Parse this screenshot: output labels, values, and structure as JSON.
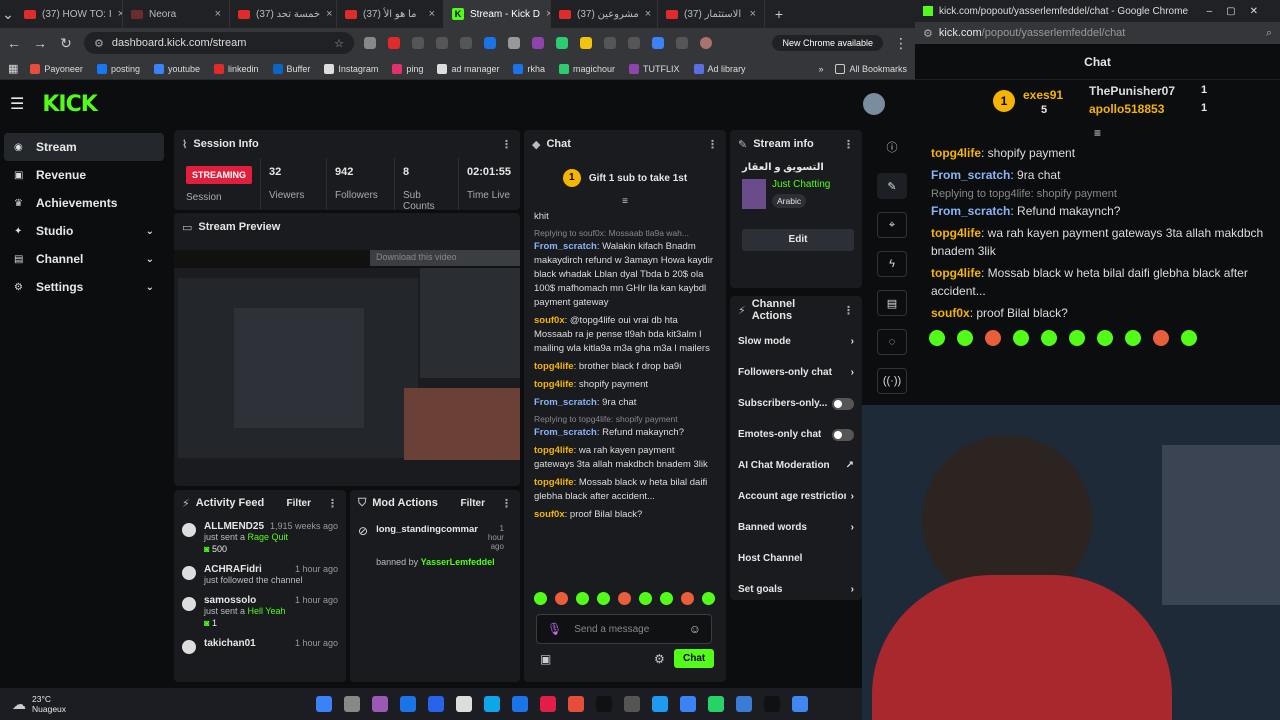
{
  "tabs": [
    {
      "label": "(37) HOW TO: I",
      "icon": "youtube"
    },
    {
      "label": "Neora",
      "icon": "web"
    },
    {
      "label": "(37) خمسة تحد",
      "icon": "youtube"
    },
    {
      "label": "(37) ما هو الأ",
      "icon": "youtube"
    },
    {
      "label": "Stream - Kick D",
      "icon": "kick",
      "active": true
    },
    {
      "label": "(37) مشروعين",
      "icon": "youtube"
    },
    {
      "label": "(37) الاستثمار",
      "icon": "youtube"
    }
  ],
  "address": "dashboard.kick.com/stream",
  "new_chrome": "New Chrome available",
  "bookmarks": [
    "Payoneer",
    "posting",
    "youtube",
    "linkedin",
    "Buffer",
    "Instagram",
    "ping",
    "ad manager",
    "rkha",
    "magichour",
    "TUTFLIX",
    "Ad library"
  ],
  "all_bookmarks": "All Bookmarks",
  "logo": "KICK",
  "sidebar": [
    "Stream",
    "Revenue",
    "Achievements",
    "Studio",
    "Channel",
    "Settings"
  ],
  "session": {
    "title": "Session Info",
    "badge": "STREAMING",
    "badge_sub": "Session",
    "stats": [
      {
        "n": "32",
        "l": "Viewers"
      },
      {
        "n": "942",
        "l": "Followers"
      },
      {
        "n": "8",
        "l": "Sub Counts"
      },
      {
        "n": "02:01:55",
        "l": "Time Live"
      }
    ]
  },
  "preview": {
    "title": "Stream Preview",
    "download": "Download this video"
  },
  "activity": {
    "title": "Activity Feed",
    "filter": "Filter",
    "items": [
      {
        "name": "ALLMEND25",
        "time": "1,915 weeks ago",
        "text": "just sent a ",
        "hl": "Rage Quit",
        "amount": "500"
      },
      {
        "name": "ACHRAFidri",
        "time": "1 hour ago",
        "text": "just followed the channel",
        "hl": "",
        "amount": ""
      },
      {
        "name": "samossolo",
        "time": "1 hour ago",
        "text": "just sent a ",
        "hl": "Hell Yeah",
        "amount": "1"
      },
      {
        "name": "takichan01",
        "time": "1 hour ago",
        "text": "",
        "hl": "",
        "amount": ""
      }
    ]
  },
  "mod": {
    "title": "Mod Actions",
    "filter": "Filter",
    "user": "long_standingcommar",
    "time": "1 hour ago",
    "banned_by": "banned by ",
    "by": "YasserLemfeddel"
  },
  "chat": {
    "title": "Chat",
    "gift": "Gift 1 sub to take 1st",
    "partial": "khit",
    "messages": [
      {
        "reply": "Replying to souf0x: Mossaab tla9a wah...",
        "user": "From_scratch",
        "color": "#8ab4f8",
        "text": "Walakin kifach Bnadm makaydirch refund w 3amayn Howa kaydir black whadak Lblan dyal Tbda b 20$ ola 100$ mafhomach mn GHIr lla kan kaybdl payment gateway"
      },
      {
        "reply": "",
        "user": "souf0x",
        "color": "#f4b400",
        "text": "@topg4life oui vrai db hta Mossaab ra je pense tl9ah bda kit3alm l mailing wla kitla9a m3a gha m3a l mailers"
      },
      {
        "reply": "",
        "user": "topg4life",
        "color": "#f4b400",
        "text": "brother black f drop ba9i"
      },
      {
        "reply": "",
        "user": "topg4life",
        "color": "#f4b400",
        "text": "shopify payment"
      },
      {
        "reply": "",
        "user": "From_scratch",
        "color": "#8ab4f8",
        "text": "9ra chat"
      },
      {
        "reply": "Replying to topg4life: shopify payment",
        "user": "From_scratch",
        "color": "#8ab4f8",
        "text": "Refund makaynch?"
      },
      {
        "reply": "",
        "user": "topg4life",
        "color": "#f4b400",
        "text": "wa rah kayen payment gateways 3ta allah makdbch bnadem 3lik"
      },
      {
        "reply": "",
        "user": "topg4life",
        "color": "#f4b400",
        "text": "Mossab black w heta bilal daifi glebha black after accident..."
      },
      {
        "reply": "",
        "user": "souf0x",
        "color": "#f4b400",
        "text": "proof Bilal black?"
      }
    ],
    "placeholder": "Send a message",
    "send": "Chat"
  },
  "stream_info": {
    "title": "Stream info",
    "stream_title": "التسويق و العقار",
    "category": "Just Chatting",
    "language": "Arabic",
    "edit": "Edit"
  },
  "channel_actions": {
    "title": "Channel Actions",
    "items": [
      {
        "label": "Slow mode",
        "type": "chevron"
      },
      {
        "label": "Followers-only chat",
        "type": "chevron"
      },
      {
        "label": "Subscribers-only...",
        "type": "toggle"
      },
      {
        "label": "Emotes-only chat",
        "type": "toggle"
      },
      {
        "label": "AI Chat Moderation",
        "type": "external"
      },
      {
        "label": "Account age restriction",
        "type": "chevron"
      },
      {
        "label": "Banned words",
        "type": "chevron"
      },
      {
        "label": "Host Channel",
        "type": "none"
      },
      {
        "label": "Set goals",
        "type": "chevron"
      }
    ]
  },
  "popout": {
    "window_title": "kick.com/popout/yasserlemfeddel/chat - Google Chrome",
    "url_host": "kick.com",
    "url_path": "/popout/yasserlemfeddel/chat",
    "header": "Chat",
    "leaders": [
      {
        "name": "exes91",
        "count": "5",
        "rank": "1"
      },
      {
        "name": "ThePunisher07",
        "count": "1"
      },
      {
        "name": "apollo518853",
        "count": "1"
      }
    ],
    "messages": [
      {
        "reply": "",
        "user": "topg4life",
        "color": "#f4b400",
        "text": "shopify payment"
      },
      {
        "reply": "",
        "user": "From_scratch",
        "color": "#8ab4f8",
        "text": "9ra chat"
      },
      {
        "reply": "Replying to topg4life: shopify payment",
        "user": "From_scratch",
        "color": "#8ab4f8",
        "text": "Refund makaynch?"
      },
      {
        "reply": "",
        "user": "topg4life",
        "color": "#f4b400",
        "text": "wa rah kayen payment gateways 3ta allah makdbch bnadem 3lik"
      },
      {
        "reply": "",
        "user": "topg4life",
        "color": "#f4b400",
        "text": "Mossab black w heta bilal daifi glebha black after accident..."
      },
      {
        "reply": "",
        "user": "souf0x",
        "color": "#f4b400",
        "text": "proof Bilal black?"
      }
    ]
  },
  "weather": {
    "temp": "23°C",
    "cond": "Nuageux"
  }
}
